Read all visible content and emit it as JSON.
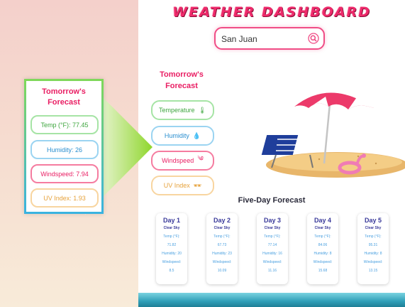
{
  "app": {
    "title": "WEATHER DASHBOARD"
  },
  "search": {
    "value": "San Juan"
  },
  "tomorrow": {
    "title": "Tomorrow's Forecast",
    "temperature_label": "Temperature",
    "humidity_label": "Humidity",
    "windspeed_label": "Windspeed",
    "uv_label": "UV Index"
  },
  "callout": {
    "title": "Tomorrow's Forecast",
    "temp": "Temp (°F): 77.45",
    "humidity": "Humidity: 26",
    "windspeed": "Windspeed: 7.94",
    "uv": "UV Index: 1.93"
  },
  "five_day": {
    "title": "Five-Day Forecast",
    "days": [
      {
        "label": "Day 1",
        "condition": "Clear Sky",
        "temp_label": "Temp (°F):",
        "temp": "71.82",
        "humidity": "Humidity: 20",
        "wind_label": "Windspeed:",
        "wind": "8.5"
      },
      {
        "label": "Day 2",
        "condition": "Clear Sky",
        "temp_label": "Temp (°F):",
        "temp": "67.73",
        "humidity": "Humidity: 23",
        "wind_label": "Windspeed:",
        "wind": "10.09"
      },
      {
        "label": "Day 3",
        "condition": "Clear Sky",
        "temp_label": "Temp (°F):",
        "temp": "77.14",
        "humidity": "Humidity: 16",
        "wind_label": "Windspeed:",
        "wind": "11.16"
      },
      {
        "label": "Day 4",
        "condition": "Clear Sky",
        "temp_label": "Temp (°F):",
        "temp": "84.06",
        "humidity": "Humidity: 8",
        "wind_label": "Windspeed:",
        "wind": "15.68"
      },
      {
        "label": "Day 5",
        "condition": "Clear Sky",
        "temp_label": "Temp (°F):",
        "temp": "95.31",
        "humidity": "Humidity: 8",
        "wind_label": "Windspeed:",
        "wind": "13.15"
      }
    ]
  },
  "icons": {
    "search": "search-icon",
    "temperature": "thermometer-icon",
    "humidity": "humidity-icon",
    "windspeed": "wind-icon",
    "uv": "sunglasses-icon"
  },
  "colors": {
    "accent": "#e91e63",
    "green": "#3da53e",
    "blue": "#2a8fd0",
    "orange": "#e6a23c"
  }
}
